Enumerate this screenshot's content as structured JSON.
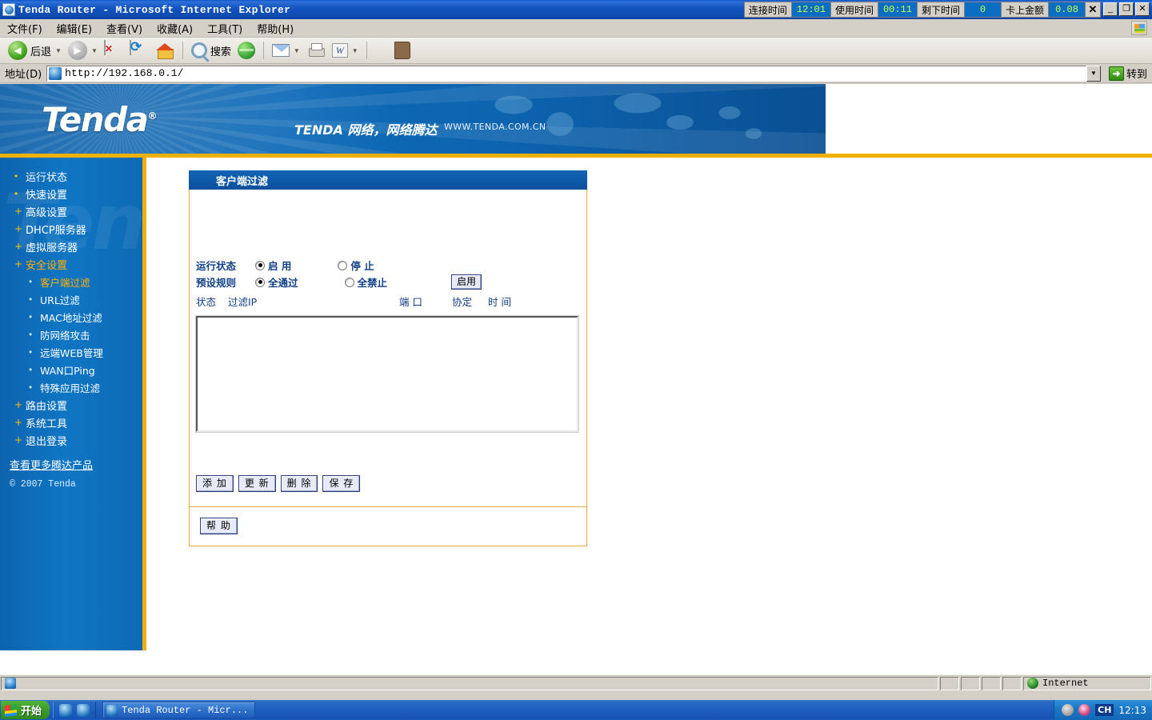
{
  "window": {
    "title": "Tenda Router - Microsoft Internet Explorer",
    "icon": "ie-document-icon",
    "minimize": "_",
    "maximize": "❐",
    "close": "✕",
    "status_widgets": [
      {
        "label": "连接时间",
        "value": "12:01"
      },
      {
        "label": "使用时间",
        "value": "00:11"
      },
      {
        "label": "剩下时间",
        "value": "0"
      },
      {
        "label": "卡上金额",
        "value": "0.08"
      }
    ],
    "status_close": "✕"
  },
  "menubar": {
    "items": [
      {
        "text": "文件",
        "accel": "(F)"
      },
      {
        "text": "编辑",
        "accel": "(E)"
      },
      {
        "text": "查看",
        "accel": "(V)"
      },
      {
        "text": "收藏",
        "accel": "(A)"
      },
      {
        "text": "工具",
        "accel": "(T)"
      },
      {
        "text": "帮助",
        "accel": "(H)"
      }
    ]
  },
  "toolbar": {
    "back_label": "后退",
    "search_label": "搜索",
    "icons": [
      "back-icon",
      "forward-icon",
      "stop-icon",
      "refresh-icon",
      "home-icon",
      "search-icon",
      "media-icon",
      "mail-icon",
      "print-icon",
      "edit-word-icon",
      "messenger-icon"
    ]
  },
  "addressbar": {
    "label": "地址",
    "accel": "(D)",
    "url": "http://192.168.0.1/",
    "go_label": "转到"
  },
  "banner": {
    "logo": "Tenda",
    "logo_mark": "®",
    "slogan": "TENDA 网络，网络腾达",
    "url": "WWW.TENDA.COM.CN"
  },
  "sidebar": {
    "watermark": "Tenda",
    "items": [
      {
        "label": "运行状态",
        "marker": "•",
        "level": 0,
        "active": false
      },
      {
        "label": "快速设置",
        "marker": "•",
        "level": 0,
        "active": false
      },
      {
        "label": "高级设置",
        "marker": "+",
        "level": 0,
        "active": false
      },
      {
        "label": "DHCP服务器",
        "marker": "+",
        "level": 0,
        "active": false
      },
      {
        "label": "虚拟服务器",
        "marker": "+",
        "level": 0,
        "active": false
      },
      {
        "label": "安全设置",
        "marker": "+",
        "level": 0,
        "active": true
      },
      {
        "label": "客户端过滤",
        "marker": "•",
        "level": 1,
        "active": true
      },
      {
        "label": "URL过滤",
        "marker": "•",
        "level": 1,
        "active": false
      },
      {
        "label": "MAC地址过滤",
        "marker": "•",
        "level": 1,
        "active": false
      },
      {
        "label": "防网络攻击",
        "marker": "•",
        "level": 1,
        "active": false
      },
      {
        "label": "远端WEB管理",
        "marker": "•",
        "level": 1,
        "active": false
      },
      {
        "label": "WAN口Ping",
        "marker": "•",
        "level": 1,
        "active": false
      },
      {
        "label": "特殊应用过滤",
        "marker": "•",
        "level": 1,
        "active": false
      },
      {
        "label": "路由设置",
        "marker": "+",
        "level": 0,
        "active": false
      },
      {
        "label": "系统工具",
        "marker": "+",
        "level": 0,
        "active": false
      },
      {
        "label": "退出登录",
        "marker": "+",
        "level": 0,
        "active": false
      }
    ],
    "more_products": "查看更多腾达产品",
    "copyright": "© 2007 Tenda"
  },
  "panel": {
    "title": "客户端过滤",
    "rows": [
      {
        "label": "运行状态",
        "options": [
          {
            "label": "启 用",
            "selected": true
          },
          {
            "label": "停 止",
            "selected": false
          }
        ]
      },
      {
        "label": "预设规则",
        "options": [
          {
            "label": "全通过",
            "selected": true
          },
          {
            "label": "全禁止",
            "selected": false
          }
        ]
      }
    ],
    "enable_button": "启用",
    "columns": [
      "状态",
      "过滤IP",
      "端 口",
      "协定",
      "时 间"
    ],
    "list_items": [],
    "buttons": [
      "添 加",
      "更 新",
      "删 除",
      "保 存"
    ],
    "help_button": "帮 助"
  },
  "statusbar": {
    "message": "",
    "zone": "Internet",
    "zone_icon": "internet-globe-icon"
  },
  "taskbar": {
    "start": "开始",
    "quicklaunch": [
      "ie-icon",
      "show-desktop-icon"
    ],
    "tasks": [
      {
        "label": "Tenda Router - Micr..."
      }
    ],
    "tray": {
      "volume_icon": "volume-icon",
      "network_icon": "network-icon",
      "ime": "CH",
      "clock": "12:13"
    }
  }
}
